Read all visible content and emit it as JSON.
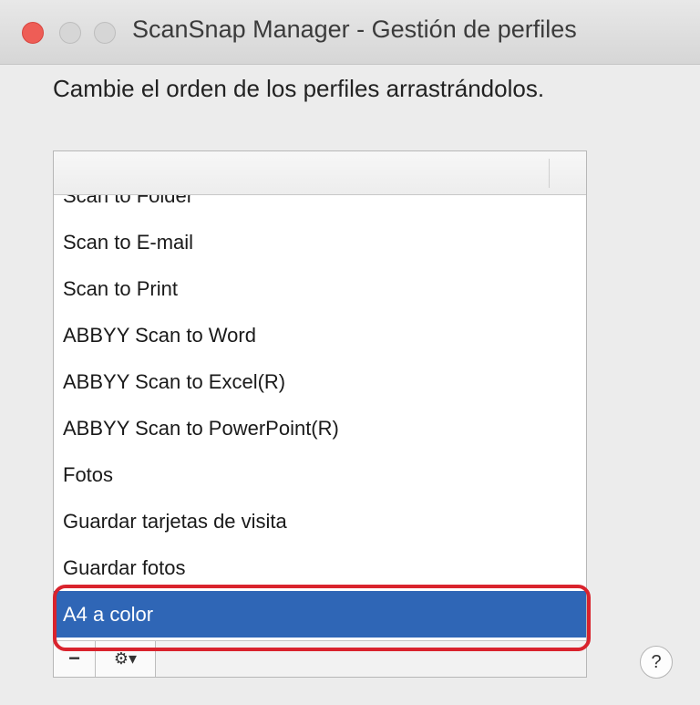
{
  "window": {
    "title": "ScanSnap Manager - Gestión de perfiles"
  },
  "instruction": "Cambie el orden de los perfiles arrastrándolos.",
  "profiles": {
    "items": [
      "Scan to Folder",
      "Scan to E-mail",
      "Scan to Print",
      "ABBYY Scan to Word",
      "ABBYY Scan to Excel(R)",
      "ABBYY Scan to PowerPoint(R)",
      "Fotos",
      "Guardar tarjetas de visita",
      "Guardar fotos",
      "A4 a color"
    ],
    "selected": "A4 a color"
  },
  "toolbar": {
    "minus_label": "−",
    "gear_label": "⚙▾"
  },
  "help": {
    "label": "?"
  },
  "colors": {
    "selection": "#2f66b6",
    "highlight_outline": "#d9232d",
    "close_button": "#ee5d56"
  },
  "icons": [
    "close-icon",
    "minimize-icon",
    "zoom-icon",
    "gear-icon",
    "help-icon"
  ]
}
